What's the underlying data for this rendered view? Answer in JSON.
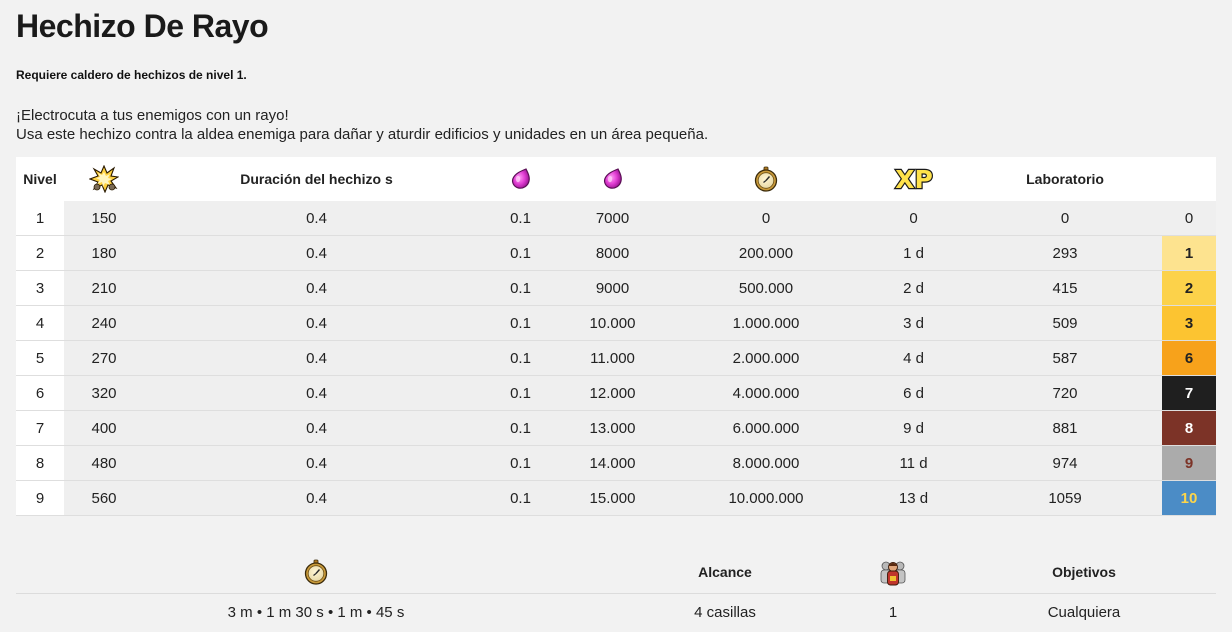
{
  "title": "Hechizo De Rayo",
  "requirement": "Requiere caldero de hechizos de nivel 1.",
  "description": [
    "¡Electrocuta a tus enemigos con un rayo!",
    "Usa este hechizo contra la aldea enemiga para dañar y aturdir edificios y unidades en un área pequeña."
  ],
  "table": {
    "headers": {
      "level": "Nivel",
      "damage_icon": "explosion-icon",
      "duration": "Duración del hechizo s",
      "elixir_icon": "elixir-drop-icon",
      "time_icon": "stopwatch-icon",
      "xp_icon": "xp-icon",
      "xp_text": "XP",
      "laboratory": "Laboratorio"
    },
    "rows": [
      {
        "level": "1",
        "damage": "150",
        "duration": "0.4",
        "radius": "0.1",
        "cost": "7000",
        "upgrade_cost": "0",
        "time": "0",
        "xp": "0",
        "lab": "0",
        "lab_color": "#efefef",
        "lab_text_color": "#222222"
      },
      {
        "level": "2",
        "damage": "180",
        "duration": "0.4",
        "radius": "0.1",
        "cost": "8000",
        "upgrade_cost": "200.000",
        "time": "1 d",
        "xp": "293",
        "lab": "1",
        "lab_color": "#fde38f",
        "lab_text_color": "#222222"
      },
      {
        "level": "3",
        "damage": "210",
        "duration": "0.4",
        "radius": "0.1",
        "cost": "9000",
        "upgrade_cost": "500.000",
        "time": "2 d",
        "xp": "415",
        "lab": "2",
        "lab_color": "#fcd24a",
        "lab_text_color": "#222222"
      },
      {
        "level": "4",
        "damage": "240",
        "duration": "0.4",
        "radius": "0.1",
        "cost": "10.000",
        "upgrade_cost": "1.000.000",
        "time": "3 d",
        "xp": "509",
        "lab": "3",
        "lab_color": "#fcc431",
        "lab_text_color": "#222222"
      },
      {
        "level": "5",
        "damage": "270",
        "duration": "0.4",
        "radius": "0.1",
        "cost": "11.000",
        "upgrade_cost": "2.000.000",
        "time": "4 d",
        "xp": "587",
        "lab": "6",
        "lab_color": "#f7a21b",
        "lab_text_color": "#222222"
      },
      {
        "level": "6",
        "damage": "320",
        "duration": "0.4",
        "radius": "0.1",
        "cost": "12.000",
        "upgrade_cost": "4.000.000",
        "time": "6 d",
        "xp": "720",
        "lab": "7",
        "lab_color": "#1f1f1f",
        "lab_text_color": "#ffffff"
      },
      {
        "level": "7",
        "damage": "400",
        "duration": "0.4",
        "radius": "0.1",
        "cost": "13.000",
        "upgrade_cost": "6.000.000",
        "time": "9 d",
        "xp": "881",
        "lab": "8",
        "lab_color": "#7c3327",
        "lab_text_color": "#ffffff"
      },
      {
        "level": "8",
        "damage": "480",
        "duration": "0.4",
        "radius": "0.1",
        "cost": "14.000",
        "upgrade_cost": "8.000.000",
        "time": "11 d",
        "xp": "974",
        "lab": "9",
        "lab_color": "#ababab",
        "lab_text_color": "#7c3327"
      },
      {
        "level": "9",
        "damage": "560",
        "duration": "0.4",
        "radius": "0.1",
        "cost": "15.000",
        "upgrade_cost": "10.000.000",
        "time": "13 d",
        "xp": "1059",
        "lab": "10",
        "lab_color": "#4b8cc6",
        "lab_text_color": "#fdd54a"
      }
    ]
  },
  "info": {
    "headers": {
      "time_icon": "stopwatch-icon",
      "range": "Alcance",
      "housing_icon": "housing-space-icon",
      "targets": "Objetivos"
    },
    "values": {
      "cooldown": "3 m • 1 m 30 s • 1 m • 45 s",
      "range": "4 casillas",
      "housing": "1",
      "targets": "Cualquiera"
    }
  }
}
